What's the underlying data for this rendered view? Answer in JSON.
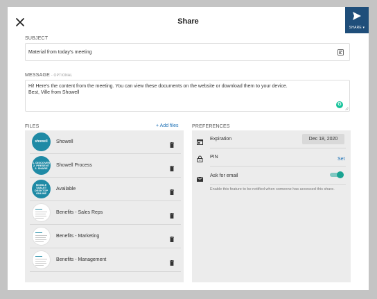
{
  "dialog": {
    "title": "Share",
    "share_button_label": "SHARE ▾"
  },
  "subject": {
    "label": "SUBJECT",
    "value": "Material from today's meeting"
  },
  "message": {
    "label": "MESSAGE",
    "optional": "- OPTIONAL",
    "value": "Hi! Here's the content from the meeting. You can view these documents on the website or download them to your device.\nBest, Ville from Showell"
  },
  "files": {
    "label": "FILES",
    "add_label": "+ Add files",
    "items": [
      {
        "name": "Showell",
        "thumb_text": "showell"
      },
      {
        "name": "Showell Process",
        "thumb_text": "1. DISCOVER\n2. PRESENT\n3. SHARE"
      },
      {
        "name": "Available",
        "thumb_text": "MOBILE\nTABLET\nDESKTOP\nONLINE"
      },
      {
        "name": "Benefits - Sales Reps",
        "thumb_text": ""
      },
      {
        "name": "Benefits - Marketing",
        "thumb_text": ""
      },
      {
        "name": "Benefits - Management",
        "thumb_text": ""
      }
    ]
  },
  "preferences": {
    "label": "PREFERENCES",
    "expiration_label": "Expiration",
    "expiration_value": "Dec 18, 2020",
    "pin_label": "PIN",
    "pin_action": "Set",
    "email_label": "Ask for email",
    "email_enabled": true,
    "email_hint": "Enable this feature to be notified when someone has accessed this share."
  },
  "colors": {
    "share_button_bg": "#1f4e7a",
    "link": "#1a6fb5",
    "toggle_on": "#1aa392",
    "thumb_teal": "#1f8aa5"
  }
}
